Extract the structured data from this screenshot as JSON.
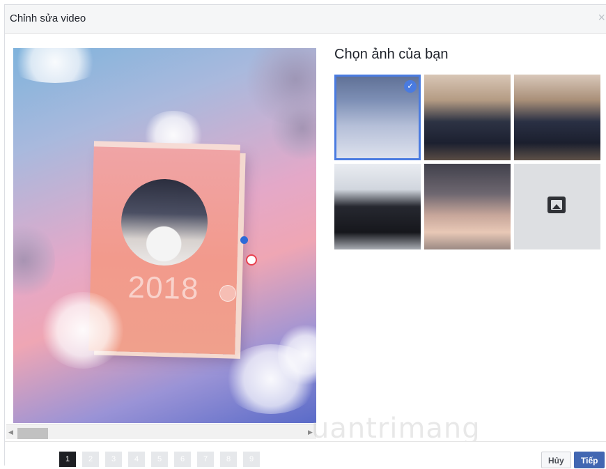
{
  "dialog": {
    "title": "Chỉnh sửa video",
    "close_label": "×"
  },
  "preview": {
    "year_text": "2018"
  },
  "panel": {
    "title": "Chọn ảnh của bạn",
    "photos": [
      {
        "selected": true
      },
      {
        "selected": false
      },
      {
        "selected": false
      },
      {
        "selected": false
      },
      {
        "selected": false
      }
    ],
    "add_icon": "add-photo-icon",
    "check_mark": "✓"
  },
  "footer": {
    "pages": [
      "1",
      "2",
      "3",
      "4",
      "5",
      "6",
      "7",
      "8",
      "9"
    ],
    "active_page": "1",
    "cancel_label": "Hủy",
    "next_label": "Tiếp"
  },
  "watermark": "uantrimang",
  "colors": {
    "accent": "#4267b2",
    "selection": "#4a7be0",
    "arrow": "#e8231b"
  }
}
